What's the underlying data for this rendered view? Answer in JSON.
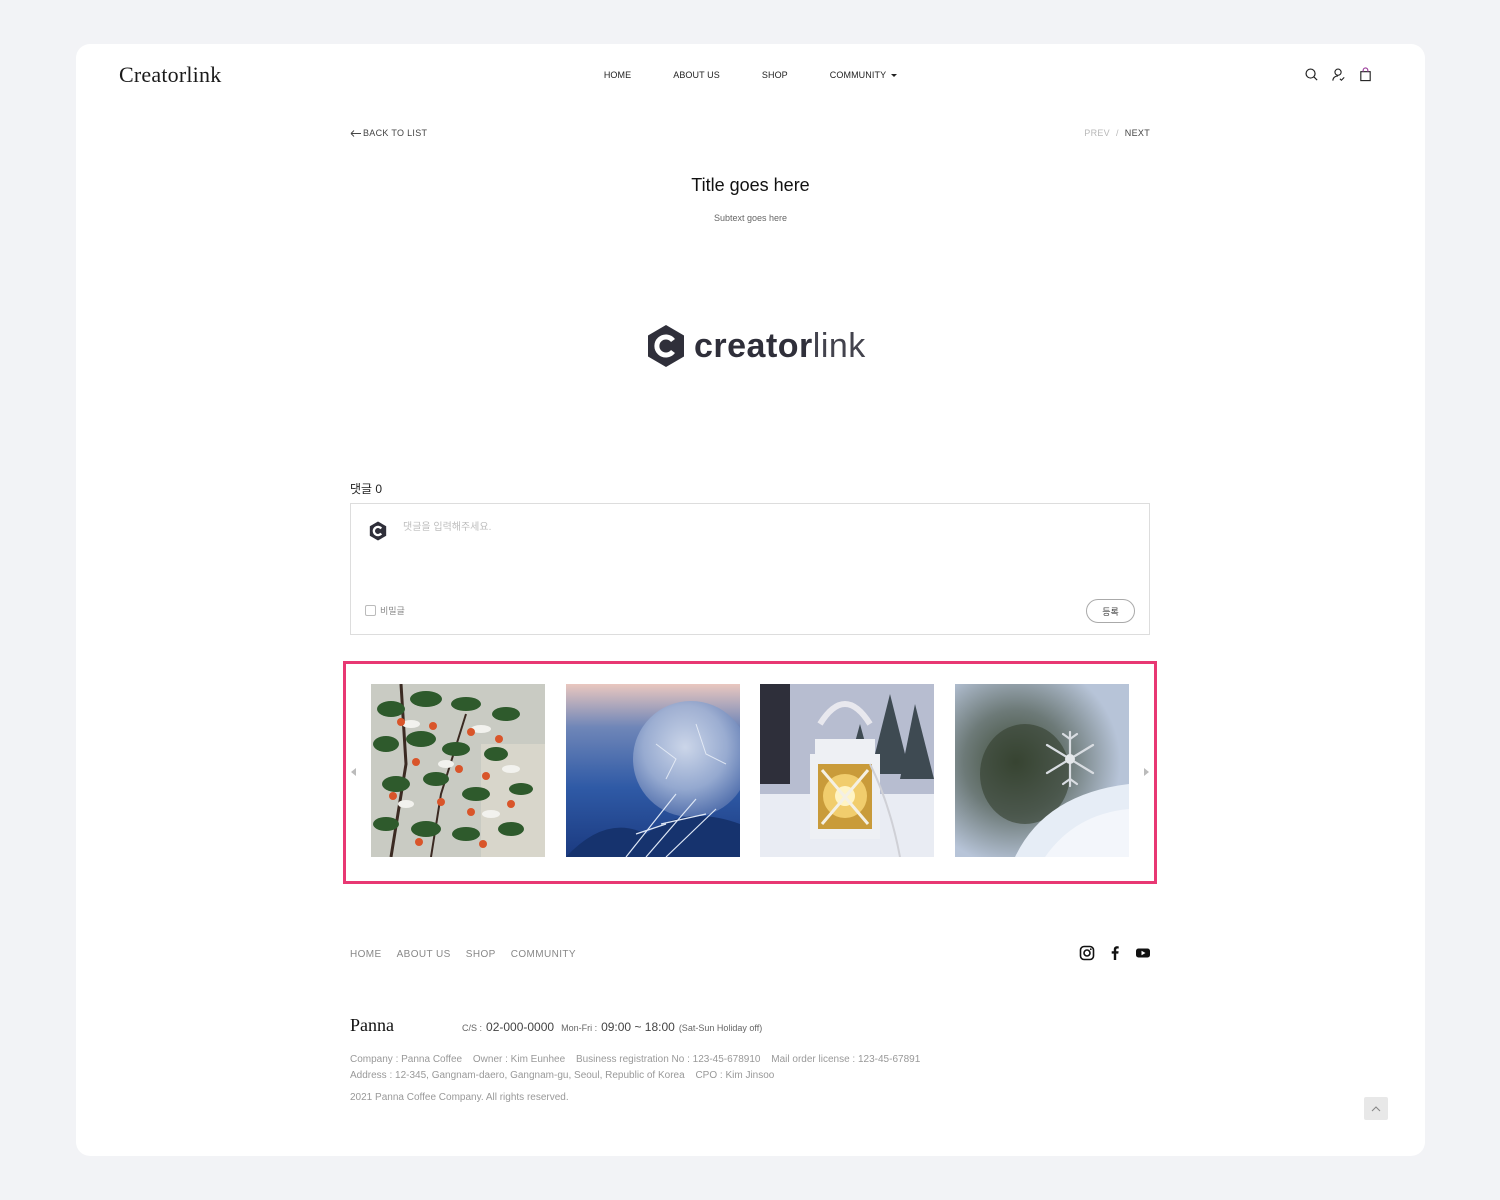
{
  "header": {
    "logo": "Creatorlink",
    "nav": [
      {
        "label": "HOME"
      },
      {
        "label": "ABOUT US"
      },
      {
        "label": "SHOP"
      },
      {
        "label": "COMMUNITY"
      }
    ],
    "icons": [
      "search-icon",
      "user-icon",
      "cart-icon"
    ]
  },
  "post": {
    "back_label": "BACK TO LIST",
    "prev_label": "PREV",
    "separator": "/",
    "next_label": "NEXT",
    "title": "Title goes here",
    "subtitle": "Subtext goes here",
    "brand_text_bold": "creator",
    "brand_text_light": "link"
  },
  "comments": {
    "count_label": "댓글 0",
    "placeholder": "댓글을 입력해주세요.",
    "secret_label": "비밀글",
    "submit_label": "등록"
  },
  "gallery": {
    "highlight_color": "#e83873",
    "images": [
      {
        "name": "winter-berries-image"
      },
      {
        "name": "frozen-bubble-image"
      },
      {
        "name": "snow-lantern-image"
      },
      {
        "name": "snowflake-image"
      }
    ]
  },
  "footer": {
    "nav": [
      "HOME",
      "ABOUT US",
      "SHOP",
      "COMMUNITY"
    ],
    "social": [
      "instagram-icon",
      "facebook-icon",
      "youtube-icon"
    ],
    "brand": "Panna",
    "cs_label": "C/S :",
    "cs_phone": "02-000-0000",
    "cs_days": "Mon-Fri :",
    "cs_hours": "09:00 ~ 18:00",
    "cs_note": "(Sat-Sun Holiday off)",
    "company": "Company : Panna Coffee",
    "owner": "Owner : Kim Eunhee",
    "business_no": "Business registration No : 123-45-678910",
    "mail_order": "Mail order license : 123-45-67891",
    "address": "Address : 12-345, Gangnam-daero, Gangnam-gu, Seoul, Republic of Korea",
    "cpo": "CPO : Kim Jinsoo",
    "copyright": "2021 Panna Coffee Company. All rights reserved."
  }
}
